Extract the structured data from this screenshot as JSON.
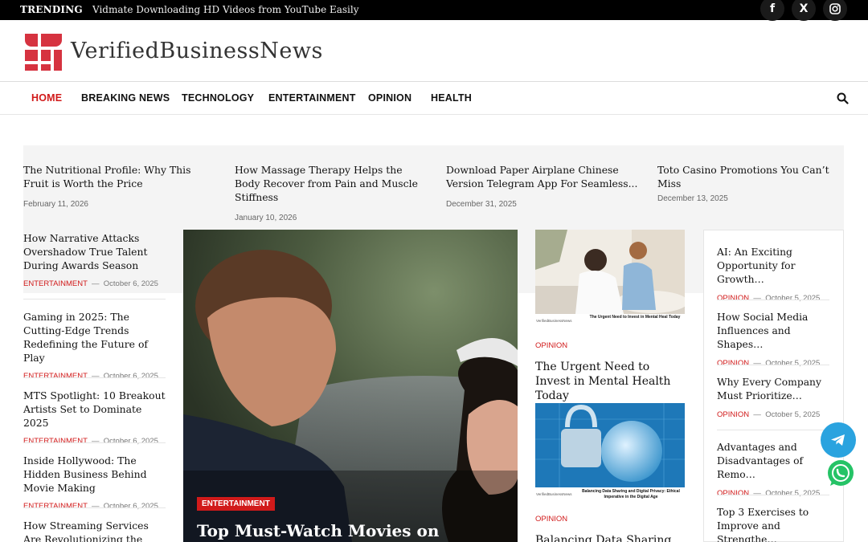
{
  "topbar": {
    "trending_label": "TRENDING",
    "trending_text": "Vidmate Downloading HD Videos from YouTube Easily",
    "social": [
      "facebook-icon",
      "x-icon",
      "instagram-icon"
    ]
  },
  "brand": {
    "name": "VerifiedBusinessNews",
    "accent": "#d11a1a"
  },
  "nav": {
    "items": [
      "HOME",
      "BREAKING NEWS",
      "TECHNOLOGY",
      "ENTERTAINMENT",
      "OPINION",
      "HEALTH"
    ],
    "active": "HOME"
  },
  "ticker": [
    {
      "title": "The Nutritional Profile: Why This Fruit is Worth the Price",
      "date": "February 11, 2026"
    },
    {
      "title": "How Massage Therapy Helps the Body Recover from Pain and Muscle Stiffness",
      "date": "January 10, 2026"
    },
    {
      "title": "Download Paper Airplane Chinese Version Telegram App For Seamless...",
      "date": "December 31, 2025"
    },
    {
      "title": "Toto Casino Promotions You Can’t Miss",
      "date": "December 13, 2025"
    }
  ],
  "left_list": [
    {
      "title": "How Narrative Attacks Overshadow True Talent During Awards Season",
      "category": "ENTERTAINMENT",
      "date": "October 6, 2025"
    },
    {
      "title": "Gaming in 2025: The Cutting-Edge Trends Redefining the Future of Play",
      "category": "ENTERTAINMENT",
      "date": "October 6, 2025"
    },
    {
      "title": "MTS Spotlight: 10 Breakout Artists Set to Dominate 2025",
      "category": "ENTERTAINMENT",
      "date": "October 6, 2025"
    },
    {
      "title": "Inside Hollywood: The Hidden Business Behind Movie Making",
      "category": "ENTERTAINMENT",
      "date": "October 6, 2025"
    },
    {
      "title": "How Streaming Services Are Revolutionizing the Film",
      "category": "",
      "date": ""
    }
  ],
  "hero": {
    "category": "ENTERTAINMENT",
    "title": "Top Must-Watch Movies on"
  },
  "middle": [
    {
      "category": "OPINION",
      "title": "The Urgent Need to Invest in Mental Health Today",
      "img_caption": "The Urgent Need to Invest in Mental Heal Today",
      "img_brand": "VerifiedBusinessNews"
    },
    {
      "category": "OPINION",
      "title": "Balancing Data Sharing and",
      "img_caption": "Balancing Data Sharing and Digital Privacy: Ethical Imperative in the Digital Age",
      "img_brand": "VerifiedBusinessNews"
    }
  ],
  "right_list": [
    {
      "title": "AI: An Exciting Opportunity for Growth…",
      "category": "OPINION",
      "date": "October 5, 2025"
    },
    {
      "title": "How Social Media Influences and Shapes…",
      "category": "OPINION",
      "date": "October 5, 2025"
    },
    {
      "title": "Why Every Company Must Prioritize…",
      "category": "OPINION",
      "date": "October 5, 2025"
    },
    {
      "title": "Advantages and Disadvantages of Remo…",
      "category": "OPINION",
      "date": "October 5, 2025"
    },
    {
      "title": "Top 3 Exercises to Improve and Strengthe…",
      "category": "",
      "date": ""
    }
  ],
  "floating": [
    "telegram-icon",
    "whatsapp-icon"
  ]
}
